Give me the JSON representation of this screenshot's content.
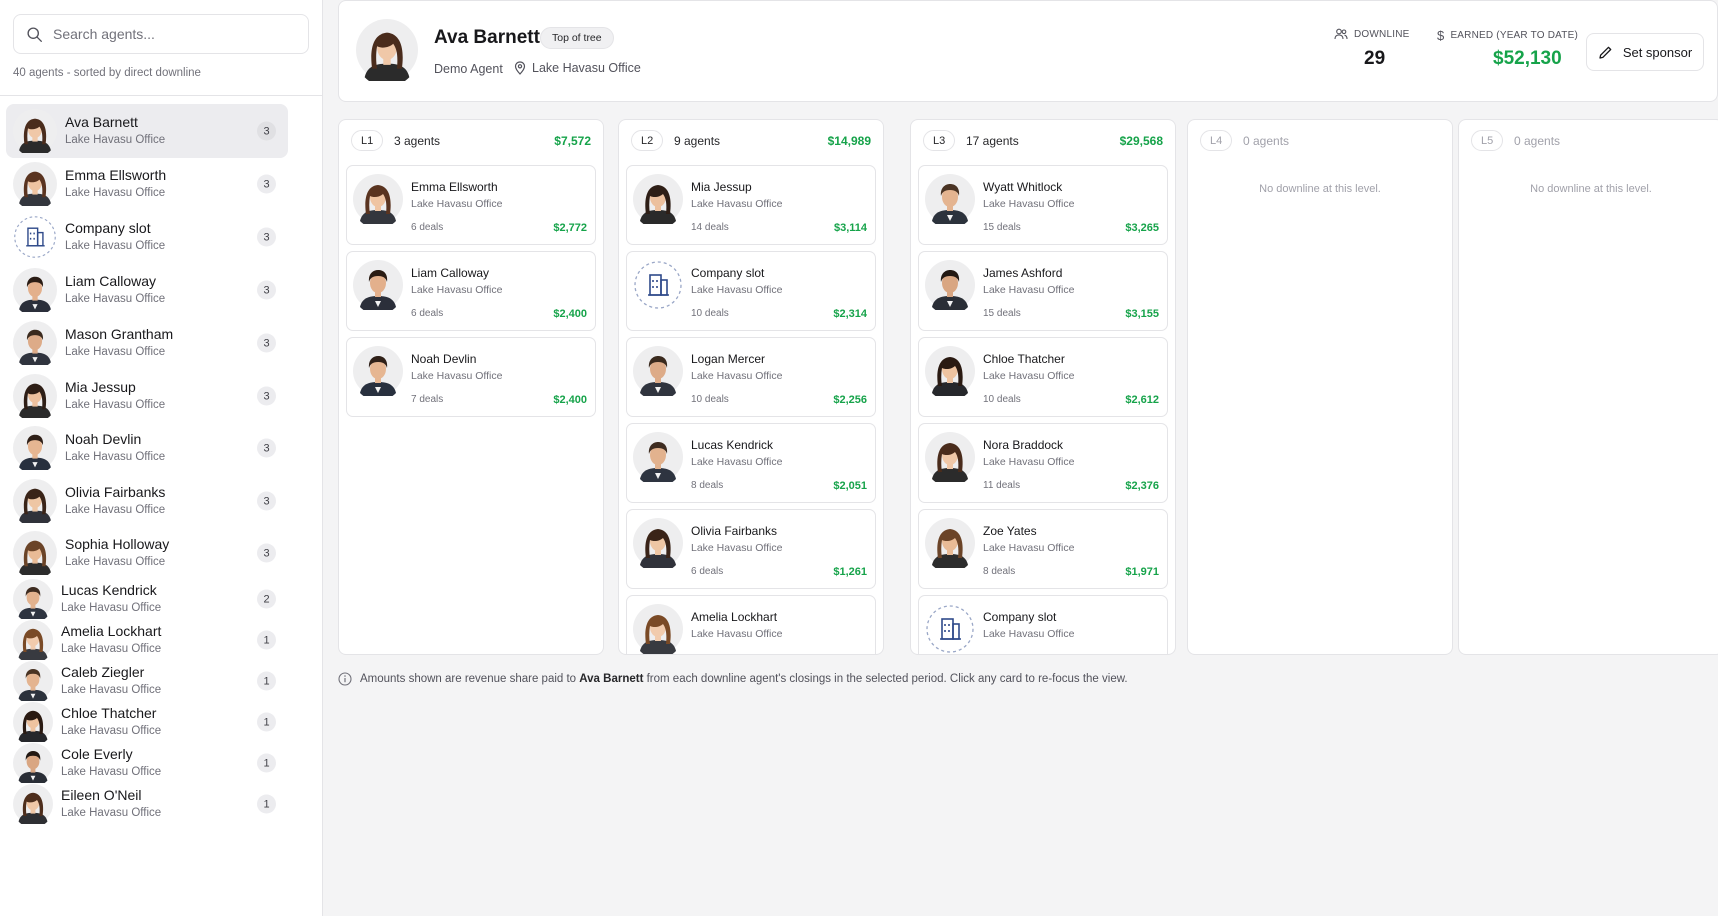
{
  "search": {
    "placeholder": "Search agents..."
  },
  "sidebar": {
    "sort_note": "40 agents - sorted by direct downline",
    "agents": [
      {
        "name": "Ava Barnett",
        "office": "Lake Havasu Office",
        "count": "3",
        "avatar": "f1",
        "selected": true
      },
      {
        "name": "Emma Ellsworth",
        "office": "Lake Havasu Office",
        "count": "3",
        "avatar": "f2"
      },
      {
        "name": "Company slot",
        "office": "Lake Havasu Office",
        "count": "3",
        "avatar": "company"
      },
      {
        "name": "Liam Calloway",
        "office": "Lake Havasu Office",
        "count": "3",
        "avatar": "m1"
      },
      {
        "name": "Mason Grantham",
        "office": "Lake Havasu Office",
        "count": "3",
        "avatar": "m2"
      },
      {
        "name": "Mia Jessup",
        "office": "Lake Havasu Office",
        "count": "3",
        "avatar": "f3"
      },
      {
        "name": "Noah Devlin",
        "office": "Lake Havasu Office",
        "count": "3",
        "avatar": "m3"
      },
      {
        "name": "Olivia Fairbanks",
        "office": "Lake Havasu Office",
        "count": "3",
        "avatar": "f4"
      },
      {
        "name": "Sophia Holloway",
        "office": "Lake Havasu Office",
        "count": "3",
        "avatar": "f5"
      },
      {
        "name": "Lucas Kendrick",
        "office": "Lake Havasu Office",
        "count": "2",
        "avatar": "m4"
      },
      {
        "name": "Amelia Lockhart",
        "office": "Lake Havasu Office",
        "count": "1",
        "avatar": "f6"
      },
      {
        "name": "Caleb Ziegler",
        "office": "Lake Havasu Office",
        "count": "1",
        "avatar": "m5"
      },
      {
        "name": "Chloe Thatcher",
        "office": "Lake Havasu Office",
        "count": "1",
        "avatar": "f7"
      },
      {
        "name": "Cole Everly",
        "office": "Lake Havasu Office",
        "count": "1",
        "avatar": "m6"
      },
      {
        "name": "Eileen O'Neil",
        "office": "Lake Havasu Office",
        "count": "1",
        "avatar": "f8"
      }
    ]
  },
  "header": {
    "name": "Ava Barnett",
    "badge": "Top of tree",
    "role": "Demo Agent",
    "office": "Lake Havasu Office",
    "downline_label": "DOWNLINE",
    "downline_value": "29",
    "earned_label": "EARNED (YEAR TO DATE)",
    "earned_value": "$52,130",
    "sponsor_button": "Set sponsor"
  },
  "levels": [
    {
      "level": "L1",
      "count": "3 agents",
      "total": "$7,572",
      "cards": [
        {
          "name": "Emma Ellsworth",
          "office": "Lake Havasu Office",
          "deals": "6 deals",
          "amount": "$2,772",
          "avatar": "f2"
        },
        {
          "name": "Liam Calloway",
          "office": "Lake Havasu Office",
          "deals": "6 deals",
          "amount": "$2,400",
          "avatar": "m1"
        },
        {
          "name": "Noah Devlin",
          "office": "Lake Havasu Office",
          "deals": "7 deals",
          "amount": "$2,400",
          "avatar": "m3"
        }
      ]
    },
    {
      "level": "L2",
      "count": "9 agents",
      "total": "$14,989",
      "cards": [
        {
          "name": "Mia Jessup",
          "office": "Lake Havasu Office",
          "deals": "14 deals",
          "amount": "$3,114",
          "avatar": "f3"
        },
        {
          "name": "Company slot",
          "office": "Lake Havasu Office",
          "deals": "10 deals",
          "amount": "$2,314",
          "avatar": "company"
        },
        {
          "name": "Logan Mercer",
          "office": "Lake Havasu Office",
          "deals": "10 deals",
          "amount": "$2,256",
          "avatar": "m2"
        },
        {
          "name": "Lucas Kendrick",
          "office": "Lake Havasu Office",
          "deals": "8 deals",
          "amount": "$2,051",
          "avatar": "m4"
        },
        {
          "name": "Olivia Fairbanks",
          "office": "Lake Havasu Office",
          "deals": "6 deals",
          "amount": "$1,261",
          "avatar": "f4"
        },
        {
          "name": "Amelia Lockhart",
          "office": "Lake Havasu Office",
          "deals": "",
          "amount": "",
          "avatar": "f6"
        }
      ]
    },
    {
      "level": "L3",
      "count": "17 agents",
      "total": "$29,568",
      "cards": [
        {
          "name": "Wyatt Whitlock",
          "office": "Lake Havasu Office",
          "deals": "15 deals",
          "amount": "$3,265",
          "avatar": "m5"
        },
        {
          "name": "James Ashford",
          "office": "Lake Havasu Office",
          "deals": "15 deals",
          "amount": "$3,155",
          "avatar": "m6"
        },
        {
          "name": "Chloe Thatcher",
          "office": "Lake Havasu Office",
          "deals": "10 deals",
          "amount": "$2,612",
          "avatar": "f7"
        },
        {
          "name": "Nora Braddock",
          "office": "Lake Havasu Office",
          "deals": "11 deals",
          "amount": "$2,376",
          "avatar": "f1"
        },
        {
          "name": "Zoe Yates",
          "office": "Lake Havasu Office",
          "deals": "8 deals",
          "amount": "$1,971",
          "avatar": "f5"
        },
        {
          "name": "Company slot",
          "office": "Lake Havasu Office",
          "deals": "",
          "amount": "",
          "avatar": "company"
        }
      ]
    },
    {
      "level": "L4",
      "count": "0 agents",
      "total": "",
      "empty_text": "No downline at this level.",
      "cards": []
    },
    {
      "level": "L5",
      "count": "0 agents",
      "total": "",
      "empty_text": "No downline at this level.",
      "cards": []
    }
  ],
  "footnote": {
    "before": "Amounts shown are revenue share paid to ",
    "name": "Ava Barnett",
    "after": " from each downline agent's closings in the selected period. Click any card to re-focus the view."
  },
  "colors": {
    "green": "#16a34a",
    "company_blue": "#2f4a8a",
    "selected_row": "#ececef"
  }
}
